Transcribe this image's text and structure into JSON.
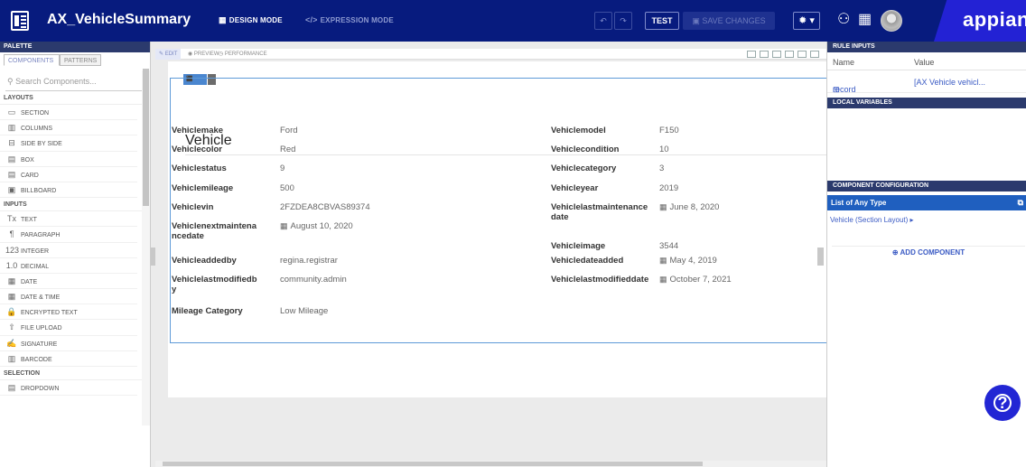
{
  "header": {
    "app_title": "AX_VehicleSummary",
    "design_mode_label": "DESIGN MODE",
    "expression_mode_label": "EXPRESSION MODE",
    "test_label": "TEST",
    "save_label": "SAVE CHANGES",
    "brand": "appian",
    "icons": {
      "undo": "undo-icon",
      "redo": "redo-icon",
      "settings": "gear-icon",
      "people": "people-icon",
      "apps": "grid-icon"
    }
  },
  "palette": {
    "header": "PALETTE",
    "tabs": [
      "COMPONENTS",
      "PATTERNS"
    ],
    "search_placeholder": "Search Components...",
    "categories": [
      {
        "label": "LAYOUTS",
        "items": [
          {
            "label": "SECTION",
            "icon": "▭"
          },
          {
            "label": "COLUMNS",
            "icon": "▥"
          },
          {
            "label": "SIDE BY SIDE",
            "icon": "⊟"
          },
          {
            "label": "BOX",
            "icon": "▤"
          },
          {
            "label": "CARD",
            "icon": "▤"
          },
          {
            "label": "BILLBOARD",
            "icon": "▣"
          }
        ]
      },
      {
        "label": "INPUTS",
        "items": [
          {
            "label": "TEXT",
            "icon": "Tx"
          },
          {
            "label": "PARAGRAPH",
            "icon": "¶"
          },
          {
            "label": "INTEGER",
            "icon": "123"
          },
          {
            "label": "DECIMAL",
            "icon": "1.0"
          },
          {
            "label": "DATE",
            "icon": "▦"
          },
          {
            "label": "DATE & TIME",
            "icon": "▦"
          },
          {
            "label": "ENCRYPTED TEXT",
            "icon": "🔒"
          },
          {
            "label": "FILE UPLOAD",
            "icon": "⇧"
          },
          {
            "label": "SIGNATURE",
            "icon": "✍"
          },
          {
            "label": "BARCODE",
            "icon": "▥"
          }
        ]
      },
      {
        "label": "SELECTION",
        "items": [
          {
            "label": "DROPDOWN",
            "icon": "▤"
          }
        ]
      }
    ]
  },
  "canvas": {
    "tabs": [
      "EDIT",
      "PREVIEW",
      "PERFORMANCE"
    ],
    "section_badge": "LAYOUT",
    "section_title": "Vehicle",
    "fields_left": [
      {
        "label": "Vehiclemake",
        "value": "Ford",
        "is_date": false
      },
      {
        "label": "Vehiclecolor",
        "value": "Red",
        "is_date": false
      },
      {
        "label": "Vehiclestatus",
        "value": "9",
        "is_date": false
      },
      {
        "label": "Vehiclemileage",
        "value": "500",
        "is_date": false
      },
      {
        "label": "Vehiclevin",
        "value": "2FZDEA8CBVAS89374",
        "is_date": false
      },
      {
        "label": "Vehiclenextmaintenancedate",
        "value": "August 10, 2020",
        "is_date": true
      },
      {
        "label": "Vehicleaddedby",
        "value": "regina.registrar",
        "is_date": false
      },
      {
        "label": "Vehiclelastmodifiedby",
        "value": "community.admin",
        "is_date": false
      },
      {
        "label": "Mileage Category",
        "value": "Low Mileage",
        "is_date": false
      }
    ],
    "fields_right": [
      {
        "label": "Vehiclemodel",
        "value": "F150",
        "is_date": false
      },
      {
        "label": "Vehiclecondition",
        "value": "10",
        "is_date": false
      },
      {
        "label": "Vehiclecategory",
        "value": "3",
        "is_date": false
      },
      {
        "label": "Vehicleyear",
        "value": "2019",
        "is_date": false
      },
      {
        "label": "Vehiclelastmaintenancedate",
        "value": "June 8, 2020",
        "is_date": true
      },
      {
        "label": "Vehicleimage",
        "value": "3544",
        "is_date": false
      },
      {
        "label": "Vehicledateadded",
        "value": "May 4, 2019",
        "is_date": true
      },
      {
        "label": "Vehiclelastmodifieddate",
        "value": "October 7, 2021",
        "is_date": true
      }
    ]
  },
  "right_panel": {
    "rule_inputs_header": "RULE INPUTS",
    "col_name": "Name",
    "col_value": "Value",
    "rule_input": {
      "name": "record",
      "value": "[AX Vehicle vehicl..."
    },
    "local_variables_header": "LOCAL VARIABLES",
    "component_config_header": "COMPONENT CONFIGURATION",
    "list_type": "List of Any Type",
    "tree_item": "Vehicle (Section Layout)",
    "add_component_label": "ADD COMPONENT"
  },
  "colors": {
    "header_bg": "#071b7e",
    "brand_bg": "#2322d4",
    "accent": "#1f5fbf",
    "link": "#3b5bc4"
  }
}
